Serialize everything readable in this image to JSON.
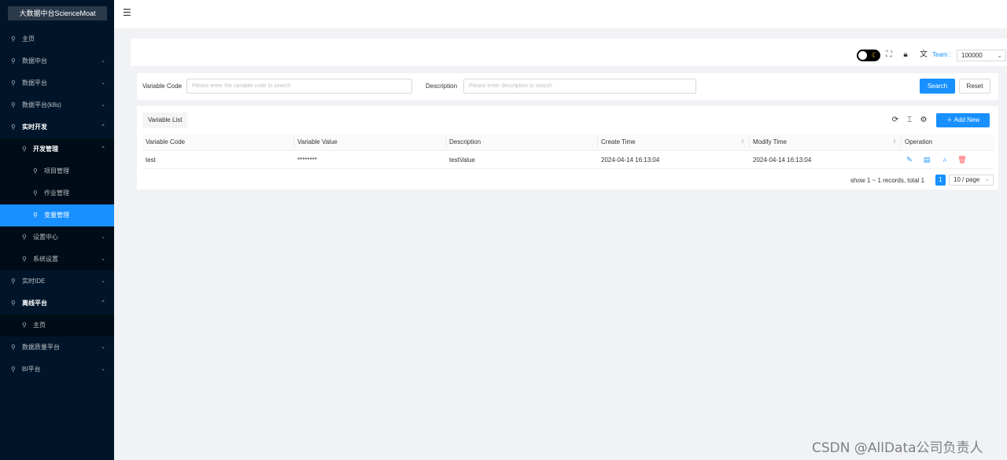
{
  "app": {
    "brand": "大数据中台ScienceMoat"
  },
  "sidebar": {
    "items": [
      {
        "label": "主页",
        "level": 1,
        "arrow": ""
      },
      {
        "label": "数据中台",
        "level": 1,
        "arrow": "⌄"
      },
      {
        "label": "数据平台",
        "level": 1,
        "arrow": "⌄"
      },
      {
        "label": "数据平台(k8s)",
        "level": 1,
        "arrow": "⌄"
      },
      {
        "label": "实时开发",
        "level": 1,
        "arrow": "⌃",
        "bold": true
      },
      {
        "label": "开发管理",
        "level": 2,
        "arrow": "⌃",
        "bold": true,
        "sub": true
      },
      {
        "label": "项目管理",
        "level": 3,
        "arrow": "",
        "sub": true
      },
      {
        "label": "作业管理",
        "level": 3,
        "arrow": "",
        "sub": true
      },
      {
        "label": "变量管理",
        "level": 3,
        "arrow": "",
        "active": true
      },
      {
        "label": "设置中心",
        "level": 2,
        "arrow": "⌄",
        "sub": true
      },
      {
        "label": "系统设置",
        "level": 2,
        "arrow": "⌄",
        "sub": true
      },
      {
        "label": "实时IDE",
        "level": 1,
        "arrow": "⌄"
      },
      {
        "label": "离线平台",
        "level": 1,
        "arrow": "⌃",
        "bold": true
      },
      {
        "label": "主页",
        "level": 2,
        "arrow": "",
        "sub": true
      },
      {
        "label": "数据质量平台",
        "level": 1,
        "arrow": "⌄"
      },
      {
        "label": "BI平台",
        "level": 1,
        "arrow": "⌄"
      }
    ],
    "item_icon": "⚲"
  },
  "header": {
    "team_label": "Team :",
    "team_value": "100000"
  },
  "search": {
    "code_label": "Variable Code",
    "code_placeholder": "Please enter the variable code to search",
    "desc_label": "Description",
    "desc_placeholder": "Please enter description to search",
    "search_button": "Search",
    "reset_button": "Reset"
  },
  "table": {
    "title": "Variable List",
    "add_button": "Add New",
    "columns": [
      "Variable Code",
      "Variable Value",
      "Description",
      "Create Time",
      "Modify Time",
      "Operation"
    ],
    "rows": [
      {
        "code": "test",
        "value": "********",
        "description": "testValue",
        "create_time": "2024-04-14 16:13:04",
        "modify_time": "2024-04-14 16:13:04"
      }
    ]
  },
  "pagination": {
    "summary": "show 1 ~ 1 records, total 1",
    "current_page": "1",
    "page_size": "10 / page"
  },
  "watermark": "CSDN @AllData公司负责人",
  "colors": {
    "sidebar_bg": "#001529",
    "accent": "#1890ff",
    "danger": "#ff4d4f"
  }
}
